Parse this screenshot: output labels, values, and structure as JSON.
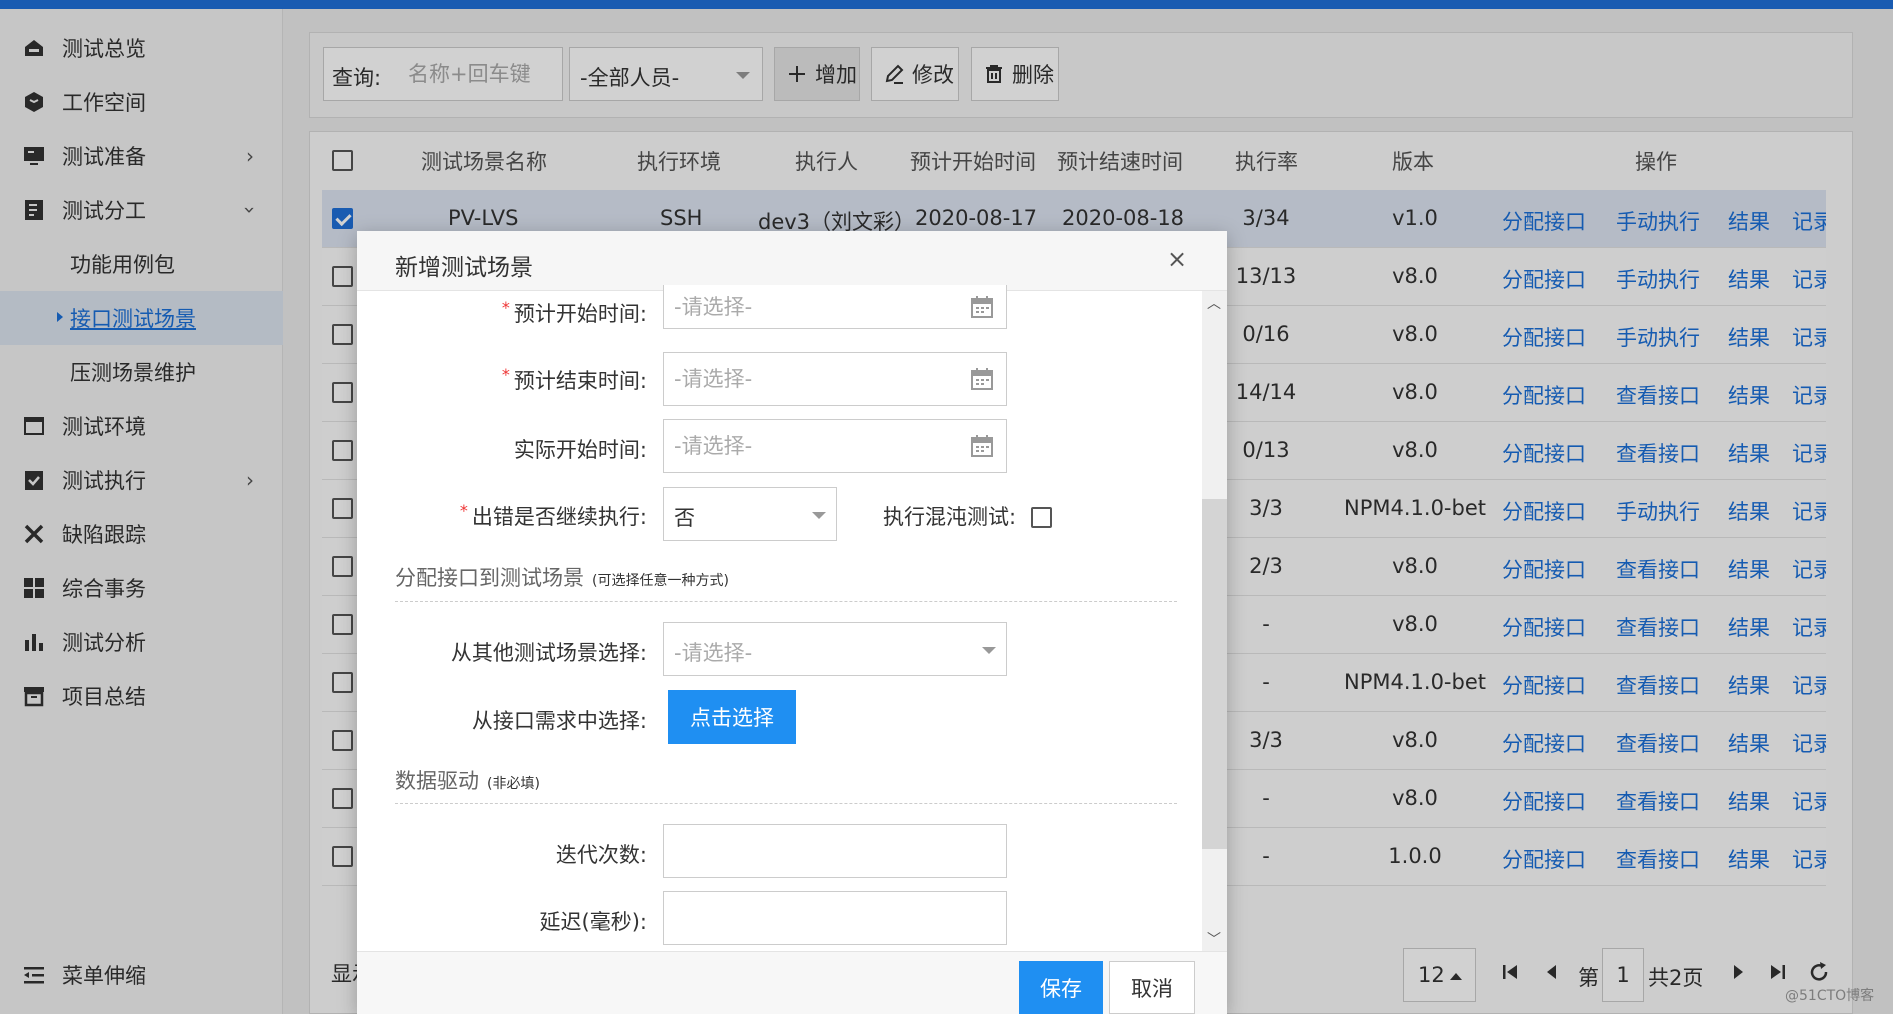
{
  "sidebar": {
    "items": [
      {
        "label": "测试总览",
        "icon": "home-icon"
      },
      {
        "label": "工作空间",
        "icon": "cube-icon"
      },
      {
        "label": "测试准备",
        "icon": "monitor-icon",
        "chevron": "right"
      },
      {
        "label": "测试分工",
        "icon": "document-icon",
        "chevron": "down"
      },
      {
        "label": "功能用例包",
        "sub": true
      },
      {
        "label": "接口测试场景",
        "sub": true,
        "active": true
      },
      {
        "label": "压测场景维护",
        "sub": true
      },
      {
        "label": "测试环境",
        "icon": "window-icon"
      },
      {
        "label": "测试执行",
        "icon": "clipboard-check-icon",
        "chevron": "right"
      },
      {
        "label": "缺陷跟踪",
        "icon": "tools-icon"
      },
      {
        "label": "综合事务",
        "icon": "grid-icon"
      },
      {
        "label": "测试分析",
        "icon": "bar-chart-icon"
      },
      {
        "label": "项目总结",
        "icon": "archive-icon"
      }
    ],
    "collapse_label": "菜单伸缩"
  },
  "toolbar": {
    "query_label": "查询:",
    "query_placeholder": "名称+回车键",
    "person_select": "-全部人员-",
    "add_label": "增加",
    "edit_label": "修改",
    "delete_label": "删除"
  },
  "table": {
    "headers": [
      "测试场景名称",
      "执行环境",
      "执行人",
      "预计开始时间",
      "预计结速时间",
      "执行率",
      "版本",
      "操作"
    ],
    "rows": [
      {
        "name": "PV-LVS",
        "env": "SSH",
        "person": "dev3（刘文彩）",
        "start": "2020-08-17",
        "end": "2020-08-18",
        "rate": "3/34",
        "version": "v1.0",
        "op1": "分配接口",
        "op2": "手动执行",
        "op3": "结果",
        "op4": "记录",
        "checked": true
      },
      {
        "rate": "13/13",
        "version": "v8.0",
        "op1": "分配接口",
        "op2": "手动执行",
        "op3": "结果",
        "op4": "记录"
      },
      {
        "rate": "0/16",
        "version": "v8.0",
        "op1": "分配接口",
        "op2": "手动执行",
        "op3": "结果",
        "op4": "记录"
      },
      {
        "rate": "14/14",
        "version": "v8.0",
        "op1": "分配接口",
        "op2": "查看接口",
        "op3": "结果",
        "op4": "记录"
      },
      {
        "rate": "0/13",
        "version": "v8.0",
        "op1": "分配接口",
        "op2": "查看接口",
        "op3": "结果",
        "op4": "记录"
      },
      {
        "rate": "3/3",
        "version": "NPM4.1.0-bet",
        "op1": "分配接口",
        "op2": "手动执行",
        "op3": "结果",
        "op4": "记录"
      },
      {
        "rate": "2/3",
        "version": "v8.0",
        "op1": "分配接口",
        "op2": "查看接口",
        "op3": "结果",
        "op4": "记录"
      },
      {
        "rate": "-",
        "version": "v8.0",
        "op1": "分配接口",
        "op2": "查看接口",
        "op3": "结果",
        "op4": "记录"
      },
      {
        "rate": "-",
        "version": "NPM4.1.0-bet",
        "op1": "分配接口",
        "op2": "查看接口",
        "op3": "结果",
        "op4": "记录"
      },
      {
        "rate": "3/3",
        "version": "v8.0",
        "op1": "分配接口",
        "op2": "查看接口",
        "op3": "结果",
        "op4": "记录"
      },
      {
        "rate": "-",
        "version": "v8.0",
        "op1": "分配接口",
        "op2": "查看接口",
        "op3": "结果",
        "op4": "记录"
      },
      {
        "rate": "-",
        "version": "1.0.0",
        "op1": "分配接口",
        "op2": "查看接口",
        "op3": "结果",
        "op4": "记录"
      }
    ],
    "footer_left": "显示"
  },
  "pager": {
    "page_size": "12",
    "page_prefix": "第",
    "page_current": "1",
    "page_total": "共2页"
  },
  "modal": {
    "title": "新增测试场景",
    "close": "×",
    "fields": {
      "plan_start_label": "预计开始时间:",
      "plan_end_label": "预计结束时间:",
      "actual_start_label": "实际开始时间:",
      "date_placeholder": "-请选择-",
      "continue_label": "出错是否继续执行:",
      "continue_value": "否",
      "chaos_label": "执行混沌测试:"
    },
    "section_assign": {
      "title": "分配接口到测试场景",
      "hint": "(可选择任意一种方式)",
      "from_scene_label": "从其他测试场景选择:",
      "from_scene_placeholder": "-请选择-",
      "from_req_label": "从接口需求中选择:",
      "pick_button": "点击选择"
    },
    "section_data": {
      "title": "数据驱动",
      "hint": "(非必填)",
      "iterations_label": "迭代次数:",
      "delay_label": "延迟(毫秒):"
    },
    "save": "保存",
    "cancel": "取消"
  },
  "watermark": "@51CTO博客",
  "colors": {
    "accent": "#1f6fd8",
    "link": "#1a6fd8",
    "primary_button": "#1f8ff2"
  }
}
